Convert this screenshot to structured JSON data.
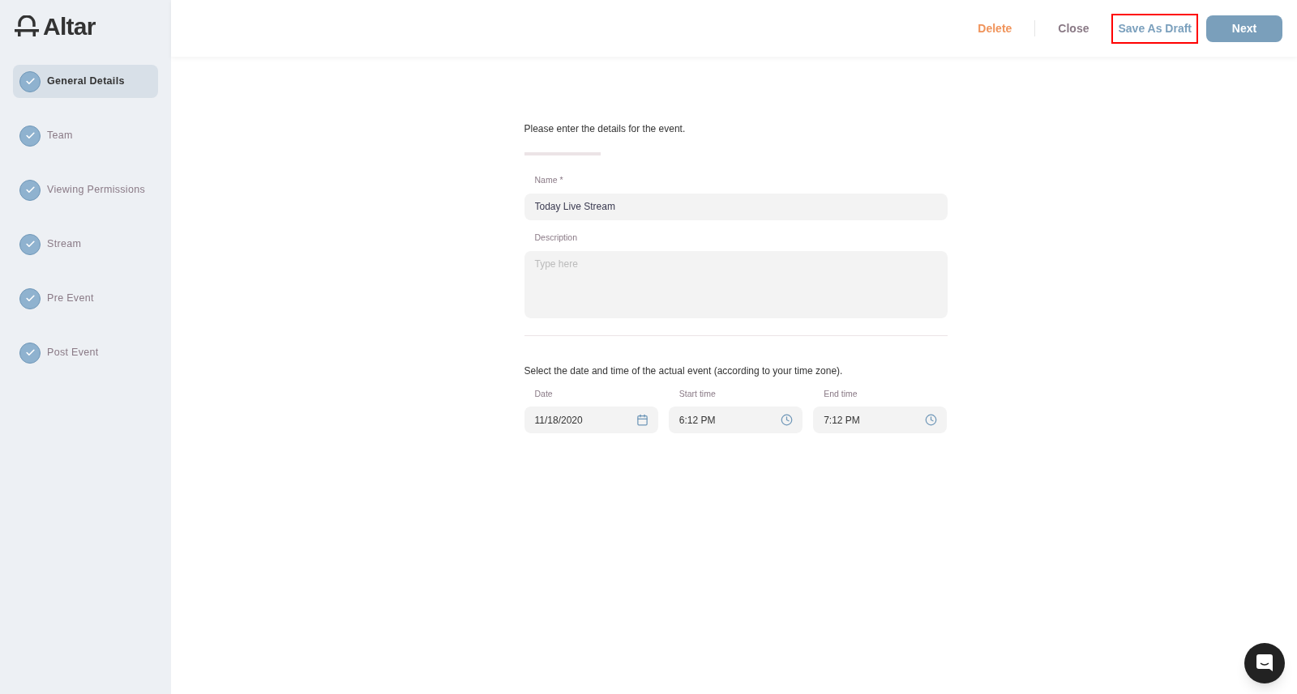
{
  "logo": {
    "text": "Altar"
  },
  "steps": [
    {
      "label": "General Details",
      "done": true,
      "selected": true
    },
    {
      "label": "Team",
      "done": true,
      "selected": false
    },
    {
      "label": "Viewing Permissions",
      "done": true,
      "selected": false
    },
    {
      "label": "Stream",
      "done": true,
      "selected": false
    },
    {
      "label": "Pre Event",
      "done": true,
      "selected": false
    },
    {
      "label": "Post Event",
      "done": true,
      "selected": false
    }
  ],
  "header": {
    "delete": "Delete",
    "close": "Close",
    "save_draft": {
      "label": "Save As Draft",
      "highlighted": true
    },
    "next": "Next"
  },
  "form": {
    "intro": "Please enter the details for the event.",
    "name": {
      "label": "Name *",
      "value": "Today Live Stream"
    },
    "description": {
      "label": "Description",
      "placeholder": "Type here"
    },
    "schedule_intro": "Select the date and time of the actual event (according to your time zone).",
    "schedule": [
      {
        "kind": "date",
        "label": "Date",
        "value": "11/18/2020"
      },
      {
        "kind": "time",
        "label": "Start time",
        "value": "6:12 PM"
      },
      {
        "kind": "time",
        "label": "End time",
        "value": "7:12 PM"
      }
    ]
  }
}
